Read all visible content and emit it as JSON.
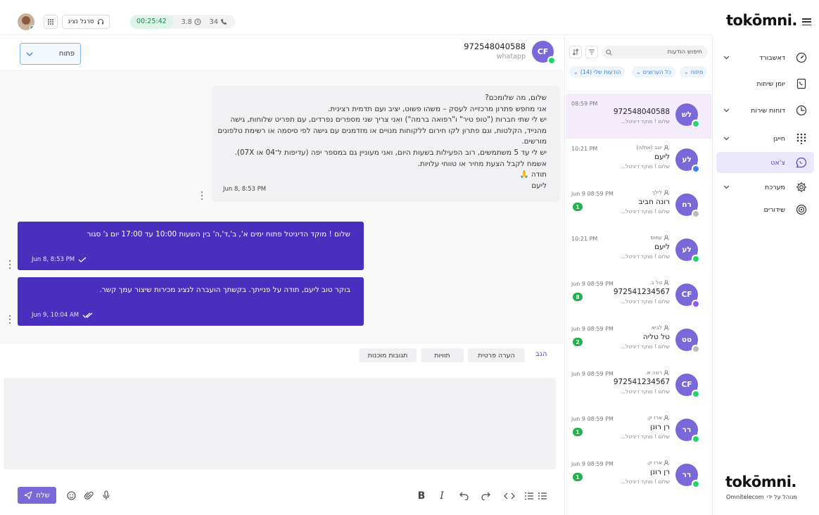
{
  "topbar": {
    "agent_label": "סרגל נציג",
    "timer": "00:25:42",
    "stat_time": "3.8",
    "stat_calls": "34"
  },
  "conversation": {
    "status": "פתוח",
    "contact_number": "972548040588",
    "contact_channel": "whatapp",
    "contact_initials": "CF",
    "incoming_lines": [
      "שלום, מה שלומכם?",
      "אני מחפש פתרון מרכזייה לעסק – משהו פשוט, יציב ועם תדמית רצינית.",
      "יש לי שתי חברות (\"טופ טיר\" ו\"רפואה ברמה\") ואני צריך שני מספרים נפרדים, עם תפריט שלוחות, גישה",
      "מהנייד, הקלטות, וגם פתרון לקו חירום ללקוחות מנויים או מזדמנים עם גישה לפי סיסמה או רשימת טלפונים",
      "מורשים.",
      "יש לי עד 5 משתמשים, רוב הפעילות בשעות היום, ואני מעוניין גם במספר יפה (עדיפות ל־04 או 07X).",
      "אשמח לקבל הצעת מחיר או טווחי עלויות.",
      "תודה 🙏",
      "ליעם"
    ],
    "incoming_time": "Jun 8, 8:53 PM",
    "outgoing": [
      {
        "text": "שלום ! מוקד הדיגיטל פתוח ימים א', ב',ד',ה' בין השעות 10:00 עד 17:00 יום ג' סגור",
        "time": "Jun 8, 8:53 PM"
      },
      {
        "text": "בוקר טוב ליעם, תודה על פנייתך. בקשתך הועברה לנציג מכירות שיצור עמך קשר.",
        "time": "Jun 9, 10:04 AM"
      }
    ]
  },
  "composer": {
    "reply_tab": "הגב",
    "private_note": "הערה פרטית",
    "tags": "תוויות",
    "canned": "תגובות מוכנות",
    "send_label": "שלח"
  },
  "list": {
    "search_placeholder": "חיפוש הודעות",
    "filters": [
      "פתוח",
      "כל הערוצים",
      "הודעות שלי (14)"
    ],
    "items": [
      {
        "initials": "לש",
        "agent": "",
        "name": "972548040588",
        "preview": "שלום ! מוקד דיגיטל...",
        "time": "08:59 PM",
        "count": "",
        "channel_color": "#25d366"
      },
      {
        "initials": "לע",
        "agent": "יוגב (את/ה)",
        "name": "ליעם",
        "preview": "שלום ! מוקד דיגיטל...",
        "time": "10:21 PM",
        "count": "",
        "channel_color": "#3b82f6"
      },
      {
        "initials": "רח",
        "agent": "לילך",
        "name": "רונה חביב",
        "preview": "שלום ! מוקד דיגיטל...",
        "time": "jun 9 08:59 PM",
        "count": "1",
        "channel_color": "#bbbbbb"
      },
      {
        "initials": "לע",
        "agent": "עמוס",
        "name": "ליעם",
        "preview": "שלום ! מוקד דיגיטל...",
        "time": "10:21 PM",
        "count": "",
        "channel_color": "#25d366"
      },
      {
        "initials": "CF",
        "agent": "טל ב.",
        "name": "972541234567",
        "preview": "שלום ! מוקד דיגיטל...",
        "time": "jun 9 08:59 PM",
        "count": "8",
        "channel_color": "#8b5cf6"
      },
      {
        "initials": "טט",
        "agent": "לביא",
        "name": "טל טליה",
        "preview": "שלום ! מוקד דיגיטל...",
        "time": "jun 9 08:59 PM",
        "count": "2",
        "channel_color": "#bbbbbb"
      },
      {
        "initials": "CF",
        "agent": "רונה א.",
        "name": "972541234567",
        "preview": "שלום ! מוקד דיגיטל...",
        "time": "jun 9 08:59 PM",
        "count": "",
        "channel_color": "#25d366"
      },
      {
        "initials": "רר",
        "agent": "ארז ק.",
        "name": "רן רונן",
        "preview": "שלום ! מוקד דיגיטל...",
        "time": "jun 9 08:59 PM",
        "count": "1",
        "channel_color": "#25d366"
      },
      {
        "initials": "רר",
        "agent": "ארז ק.",
        "name": "רן רונן",
        "preview": "שלום ! מוקד דיגיטל...",
        "time": "jun 9 08:59 PM",
        "count": "1",
        "channel_color": "#25d366"
      }
    ]
  },
  "nav": {
    "brand": "tokōmni.",
    "items": [
      {
        "label": "דאשבורד",
        "icon": "dashboard-icon",
        "chevron": true,
        "active": false
      },
      {
        "label": "יומן שיחות",
        "icon": "call-log-icon",
        "chevron": false,
        "active": false
      },
      {
        "label": "דוחות שירות",
        "icon": "reports-icon",
        "chevron": true,
        "active": false
      },
      {
        "label": "חייגן",
        "icon": "dialer-icon",
        "chevron": true,
        "active": false
      },
      {
        "label": "צ'אט",
        "icon": "chat-icon",
        "chevron": false,
        "active": true
      },
      {
        "label": "מערכת",
        "icon": "settings-icon",
        "chevron": true,
        "active": false
      },
      {
        "label": "שידורים",
        "icon": "broadcast-icon",
        "chevron": false,
        "active": false
      }
    ],
    "footer_brand": "tokōmni.",
    "footer_caption": "מנוהל על ידי",
    "footer_company": "Omnitelecom"
  },
  "colors": {
    "accent": "#7b68d8",
    "outgoing_bubble": "#4a2ebd",
    "unread_badge": "#22b14c"
  }
}
